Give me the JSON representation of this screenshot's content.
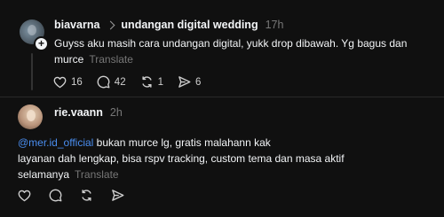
{
  "posts": [
    {
      "username": "biavarna",
      "topic": "undangan digital wedding",
      "time": "17h",
      "text": "Guyss aku masih cara undangan digital, yukk drop dibawah. Yg bagus dan murce",
      "translate": "Translate",
      "actions": {
        "likes": "16",
        "comments": "42",
        "reposts": "1",
        "shares": "6"
      }
    },
    {
      "username": "rie.vaann",
      "time": "2h",
      "mention": "@mer.id_official",
      "text_line1": " bukan murce lg, gratis malahann kak",
      "text_line2": "layanan dah lengkap, bisa rspv tracking, custom tema dan masa aktif",
      "text_line3": "selamanya",
      "translate": "Translate"
    }
  ],
  "icons": {
    "like": "heart-icon",
    "comment": "comment-icon",
    "repost": "repost-icon",
    "share": "share-icon",
    "follow": "plus-icon"
  },
  "plus_glyph": "+"
}
